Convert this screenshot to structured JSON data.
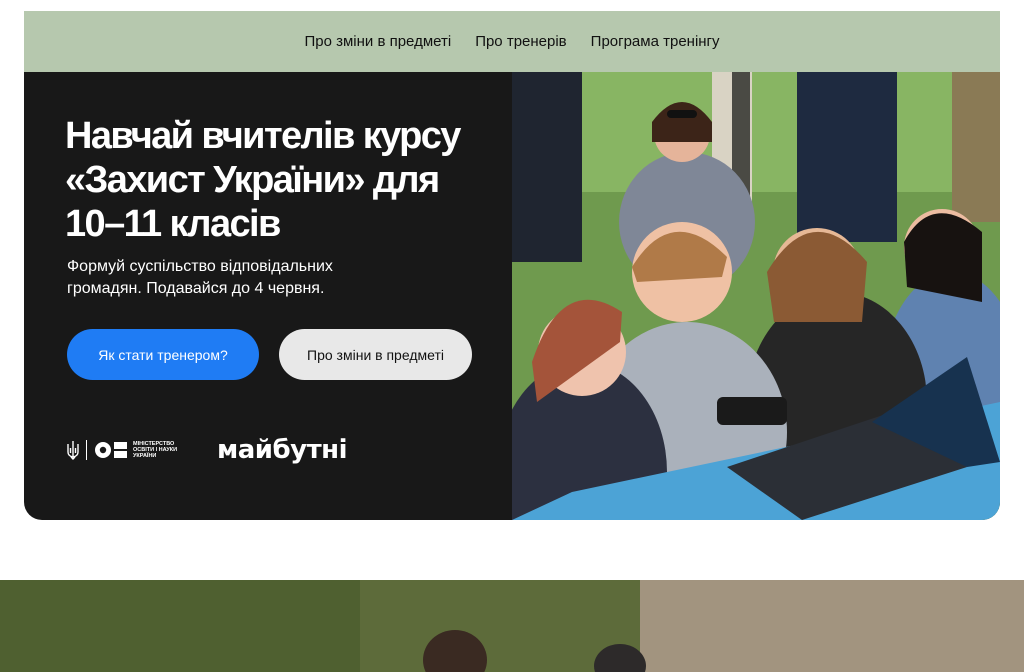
{
  "nav": {
    "items": [
      "Про зміни в предметі",
      "Про тренерів",
      "Програма тренінгу"
    ]
  },
  "hero": {
    "headline_line1": "Навчай вчителів курсу",
    "headline_line2": "«Захист України» для",
    "headline_line3": "10–11 класів",
    "subtitle_line1": "Формуй суспільство відповідальних",
    "subtitle_line2": "громадян. Подавайся до 4 червня.",
    "primary_button": "Як стати тренером?",
    "secondary_button": "Про зміни в предметі",
    "photo_icon": "students-with-laptop-photo"
  },
  "logos": {
    "ministry_line1": "МІНІСТЕРСТВО",
    "ministry_line2": "ОСВІТИ І НАУКИ",
    "ministry_line3": "УКРАЇНИ",
    "partner": "майбутні"
  },
  "colors": {
    "nav_bg": "#b6c8ae",
    "hero_bg": "#181818",
    "primary": "#1f7cf4",
    "secondary": "#e8e8e8"
  }
}
